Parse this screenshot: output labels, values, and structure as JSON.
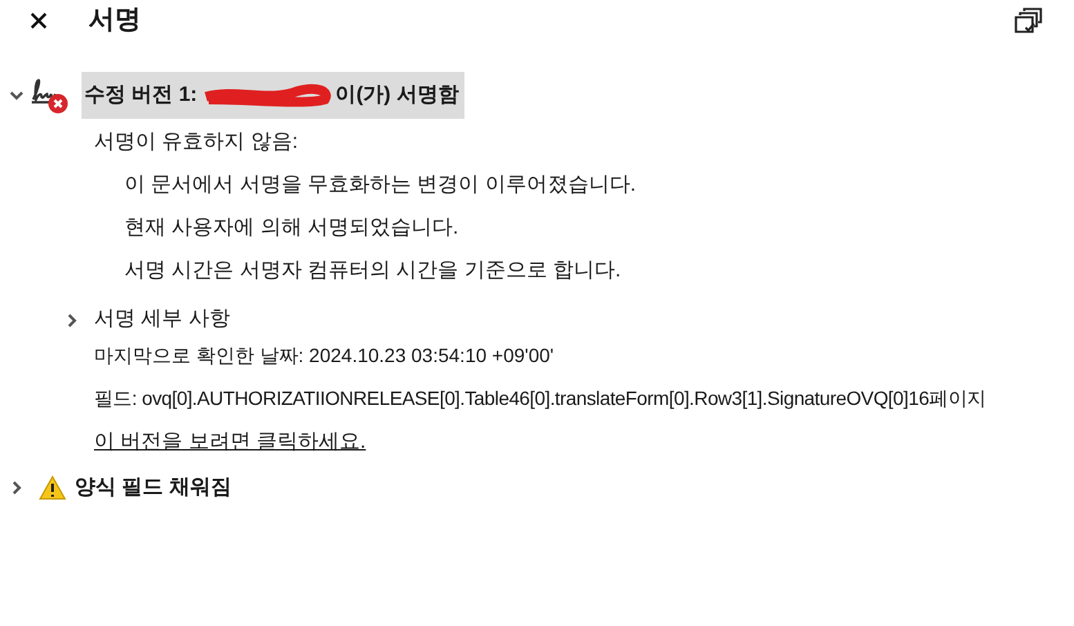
{
  "panel": {
    "title": "서명"
  },
  "signature": {
    "expanded": true,
    "invalid": true,
    "heading_prefix": "수정 버전 1:",
    "heading_suffix": "이(가) 서명함",
    "selected": true,
    "validity": "서명이 유효하지 않음:",
    "reasons": [
      "이 문서에서 서명을 무효화하는 변경이 이루어졌습니다.",
      "현재 사용자에 의해 서명되었습니다.",
      "서명 시간은 서명자 컴퓨터의 시간을 기준으로 합니다."
    ],
    "details": {
      "label": "서명 세부 사항",
      "expanded": false
    },
    "last_checked": "마지막으로 확인한 날짜: 2024.10.23 03:54:10 +09'00'",
    "field": "필드: ovq[0].AUTHORIZATIIONRELEASE[0].Table46[0].translateForm[0].Row3[1].SignatureOVQ[0]16페이지",
    "view_link": "이 버전을 보려면 클릭하세요."
  },
  "form_fields": {
    "label": "양식 필드 채워짐",
    "expanded": false,
    "warning": true
  }
}
